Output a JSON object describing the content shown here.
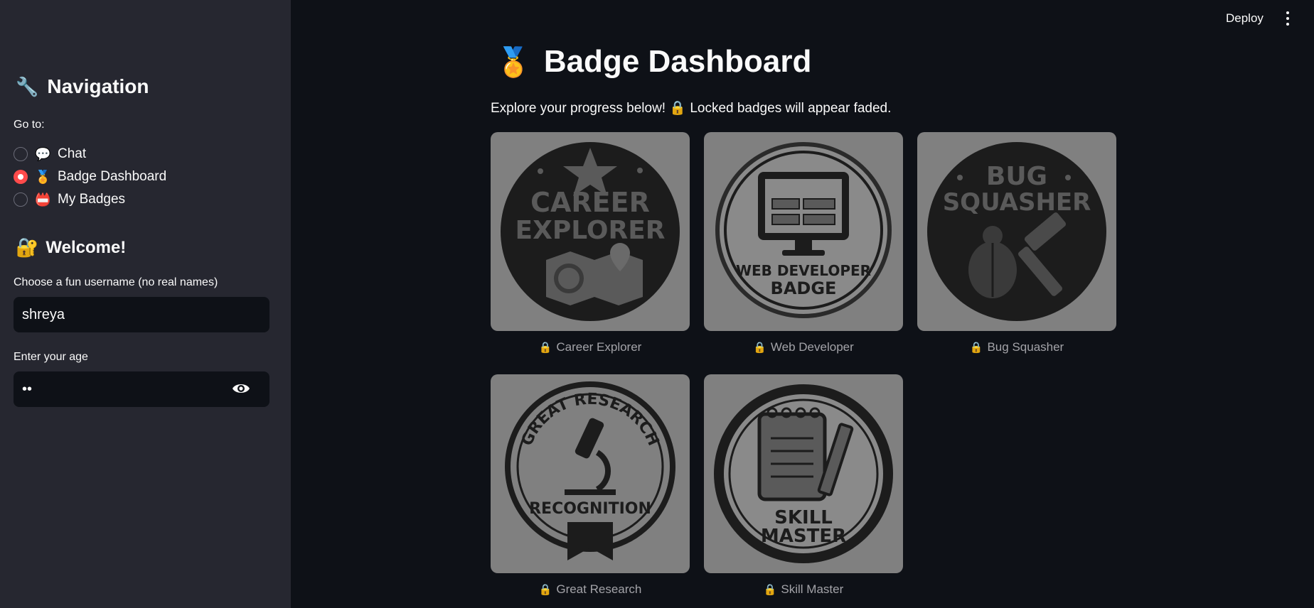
{
  "topbar": {
    "deploy_label": "Deploy",
    "menu_icon": "kebab-menu-icon"
  },
  "sidebar": {
    "nav_emoji": "🔧",
    "nav_title": "Navigation",
    "goto_label": "Go to:",
    "options": [
      {
        "emoji": "💬",
        "label": "Chat",
        "selected": false
      },
      {
        "emoji": "🏅",
        "label": "Badge Dashboard",
        "selected": true
      },
      {
        "emoji": "📛",
        "label": "My Badges",
        "selected": false
      }
    ],
    "welcome_emoji": "🔐",
    "welcome_title": "Welcome!",
    "username_label": "Choose a fun username (no real names)",
    "username_value": "shreya",
    "age_label": "Enter your age",
    "age_value": "••"
  },
  "main": {
    "title_emoji": "🏅",
    "title": "Badge Dashboard",
    "subtitle_a": "Explore your progress below!",
    "subtitle_lock": "🔒",
    "subtitle_b": "Locked badges will appear faded.",
    "lock_emoji": "🔒",
    "badges": [
      {
        "caption": "Career Explorer",
        "art_line1": "CAREER",
        "art_line2": "EXPLORER"
      },
      {
        "caption": "Web Developer",
        "art_line1": "WEB DEVELOPER",
        "art_line2": "BADGE"
      },
      {
        "caption": "Bug Squasher",
        "art_line1": "BUG",
        "art_line2": "SQUASHER"
      },
      {
        "caption": "Great Research",
        "art_line1": "GREAT RESEARCH",
        "art_line2": "RECOGNITION"
      },
      {
        "caption": "Skill Master",
        "art_line1": "SKILL",
        "art_line2": "MASTER"
      }
    ]
  },
  "colors": {
    "accent": "#ff4b4b",
    "sidebar_bg": "#262730",
    "main_bg": "#0e1117",
    "card_bg": "#808080"
  }
}
